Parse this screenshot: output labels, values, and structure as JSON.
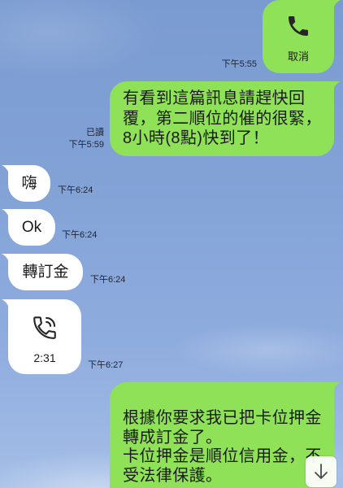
{
  "messages": [
    {
      "icon": "phone-icon",
      "label": "取消",
      "time": "下午5:55"
    },
    {
      "lines": [
        "有看到這篇訊息請趕快回",
        "覆，第二順位的催的很緊，",
        "8小時(8點)快到了！"
      ],
      "read": "已讀",
      "time": "下午5:59"
    },
    {
      "lines": [
        "嗨"
      ],
      "time": "下午6:24"
    },
    {
      "lines": [
        "Ok"
      ],
      "time": "下午6:24"
    },
    {
      "lines": [
        "轉訂金"
      ],
      "time": "下午6:24"
    },
    {
      "icon": "phone-in-talk-icon",
      "duration": "2:31",
      "time": "下午6:27"
    },
    {
      "lines": [
        "根據你要求我已把卡位押金",
        "轉成訂金了。",
        "卡位押金是順位信用金，不",
        "受法律保護。"
      ]
    }
  ],
  "scroll_button": {
    "icon": "arrow-down-icon"
  },
  "colors": {
    "outgoing_bubble": "#8fe157",
    "incoming_bubble": "#ffffff",
    "message_text": "#1b1b1b",
    "meta_text": "#1c2433"
  }
}
